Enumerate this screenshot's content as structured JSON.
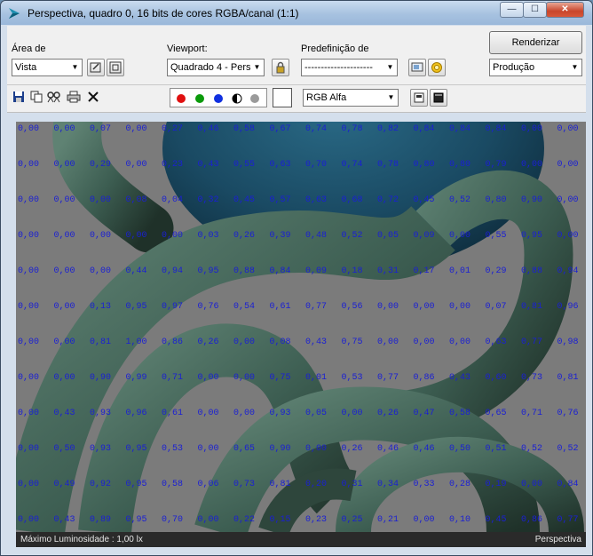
{
  "window": {
    "title": "Perspectiva, quadro 0, 16 bits de cores RGBA/canal (1:1)",
    "controls": {
      "minimize": "—",
      "maximize": "☐",
      "close": "✕"
    }
  },
  "toolbar": {
    "area_label": "Área de",
    "area_value": "Vista",
    "viewport_label": "Viewport:",
    "viewport_value": "Quadrado 4 - Pers",
    "preset_label": "Predefinição de",
    "preset_value": "---------------------",
    "render_button": "Renderizar",
    "render_mode_value": "Produção",
    "channel_value": "RGB Alfa"
  },
  "colors": {
    "red_dot": "#e01010",
    "green_dot": "#0a9a0a",
    "blue_dot": "#1030e0",
    "gray_dot": "#9a9a9a",
    "value_text": "#1a1fd4"
  },
  "luminance_grid": {
    "rows": [
      [
        "0,00",
        "0,00",
        "0,07",
        "0,00",
        "0,27",
        "0,46",
        "0,58",
        "0,67",
        "0,74",
        "0,78",
        "0,82",
        "0,84",
        "0,84",
        "0,84",
        "0,00"
      ],
      [
        "0,00",
        "0,00",
        "0,29",
        "0,00",
        "0,23",
        "0,43",
        "0,55",
        "0,63",
        "0,70",
        "0,74",
        "0,78",
        "0,80",
        "0,80",
        "0,79",
        "0,00"
      ],
      [
        "0,00",
        "0,00",
        "0,00",
        "0,08",
        "0,04",
        "0,32",
        "0,45",
        "0,57",
        "0,63",
        "0,68",
        "0,72",
        "0,45",
        "0,52",
        "0,80",
        "0,90"
      ],
      [
        "0,00",
        "0,00",
        "0,00",
        "0,00",
        "0,00",
        "0,03",
        "0,26",
        "0,39",
        "0,48",
        "0,52",
        "0,05",
        "0,09",
        "0,00",
        "0,55",
        "0,95"
      ],
      [
        "0,00",
        "0,00",
        "0,00",
        "0,44",
        "0,94",
        "0,95",
        "0,88",
        "0,84",
        "0,09",
        "0,18",
        "0,31",
        "0,17",
        "0,01",
        "0,29",
        "0,88"
      ],
      [
        "0,00",
        "0,00",
        "0,13",
        "0,95",
        "0,97",
        "0,76",
        "0,54",
        "0,61",
        "0,77",
        "0,56",
        "0,00",
        "0,00",
        "0,00",
        "0,07",
        "0,81"
      ],
      [
        "0,00",
        "0,00",
        "0,81",
        "1,00",
        "0,86",
        "0,26",
        "0,00",
        "0,08",
        "0,43",
        "0,75",
        "0,00",
        "0,00",
        "0,00",
        "0,63",
        "0,77"
      ],
      [
        "0,00",
        "0,00",
        "0,90",
        "0,99",
        "0,71",
        "0,00",
        "0,00",
        "0,75",
        "0,01",
        "0,53",
        "0,77",
        "0,86",
        "0,43",
        "0,60",
        "0,73"
      ],
      [
        "0,00",
        "0,43",
        "0,93",
        "0,96",
        "0,61",
        "0,00",
        "0,00",
        "0,93",
        "0,05",
        "0,00",
        "0,26",
        "0,47",
        "0,58",
        "0,65",
        "0,71"
      ],
      [
        "0,00",
        "0,50",
        "0,93",
        "0,95",
        "0,53",
        "0,00",
        "0,65",
        "0,90",
        "0,00",
        "0,26",
        "0,46",
        "0,46",
        "0,50",
        "0,51",
        "0,52"
      ],
      [
        "0,00",
        "0,49",
        "0,92",
        "0,95",
        "0,58",
        "0,06",
        "0,73",
        "0,81",
        "0,20",
        "0,31",
        "0,34",
        "0,33",
        "0,28",
        "0,19",
        "0,00"
      ],
      [
        "0,00",
        "0,43",
        "0,89",
        "0,95",
        "0,70",
        "0,00",
        "0,22",
        "0,15",
        "0,23",
        "0,25",
        "0,21",
        "0,00",
        "0,10",
        "0,45",
        "0,86"
      ]
    ],
    "extra_col": [
      "0,00",
      "0,00",
      "0,00",
      "0,00",
      "0,94",
      "0,96",
      "0,98",
      "0,81",
      "0,76",
      "0,52",
      "0,84",
      "0,77"
    ]
  },
  "status": {
    "left": "Máximo Luminosidade : 1,00 lx",
    "right": "Perspectiva"
  }
}
